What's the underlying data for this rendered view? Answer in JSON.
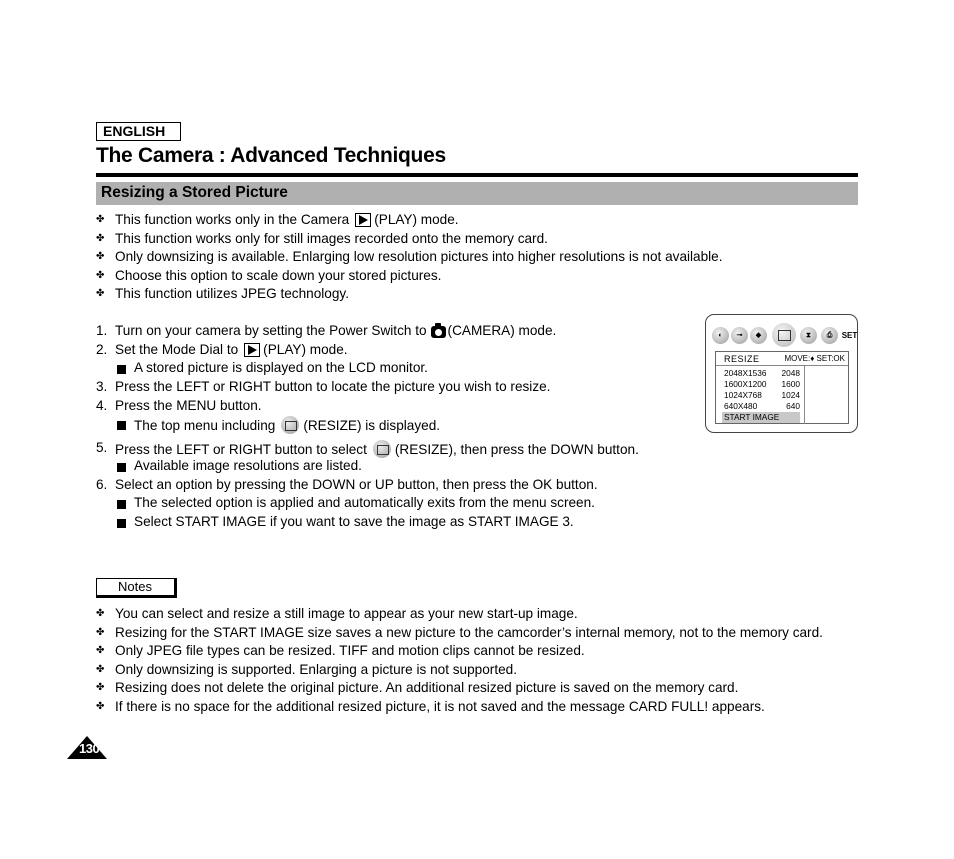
{
  "header": {
    "language": "ENGLISH",
    "title": "The Camera : Advanced Techniques",
    "section": "Resizing a Stored Picture"
  },
  "intro_bullets": [
    {
      "before": "This function works only in the Camera",
      "icon": "play-icon",
      "after": "(PLAY) mode."
    },
    {
      "text": "This function works only for still images recorded onto the memory card."
    },
    {
      "text": "Only downsizing is available. Enlarging low resolution pictures into higher resolutions is not available."
    },
    {
      "text": "Choose this option to scale down your stored pictures."
    },
    {
      "text": "This function utilizes JPEG technology."
    }
  ],
  "steps": [
    {
      "num": "1.",
      "before": "Turn on your camera by setting the Power Switch to",
      "icon": "camera-icon",
      "after": "(CAMERA) mode."
    },
    {
      "num": "2.",
      "before": "Set the Mode Dial to",
      "icon": "play-icon",
      "after": "(PLAY) mode."
    },
    {
      "sub": "A stored picture is displayed on the LCD monitor."
    },
    {
      "num": "3.",
      "text": "Press the LEFT or RIGHT button to locate the picture you wish to resize."
    },
    {
      "num": "4.",
      "text": "Press the MENU button."
    },
    {
      "sub_before": "The top menu including",
      "icon": "resize-icon",
      "sub_after": "(RESIZE) is displayed."
    },
    {
      "num": "5.",
      "before": "Press the LEFT or RIGHT button to select",
      "icon": "resize-icon",
      "after": "(RESIZE), then press the DOWN button."
    },
    {
      "sub": "Available image resolutions are listed."
    },
    {
      "num": "6.",
      "text": "Select an option by pressing the DOWN or UP button, then press the OK button."
    },
    {
      "sub": "The selected option is applied and automatically exits from the menu screen."
    },
    {
      "sub": "Select START IMAGE if you want to save the image as START IMAGE 3."
    }
  ],
  "lcd": {
    "top_icons": [
      "mode-icon",
      "key-icon",
      "dpad-icon",
      "resize-icon",
      "timer-icon",
      "print-icon",
      "set-icon"
    ],
    "set_label": "SET",
    "menu_title": "RESIZE",
    "hint": "MOVE:♦  SET:OK",
    "options": [
      {
        "res": "2048X1536",
        "value": "2048"
      },
      {
        "res": "1600X1200",
        "value": "1600"
      },
      {
        "res": "1024X768",
        "value": "1024"
      },
      {
        "res": "640X480",
        "value": "640"
      },
      {
        "res": "START IMAGE",
        "value": "",
        "selected": true
      }
    ]
  },
  "notes": {
    "label": "Notes",
    "items": [
      "You can select and resize a still image to appear as your new start-up image.",
      "Resizing for the START IMAGE size saves a new picture to the camcorder’s internal memory, not to the memory card.",
      "Only JPEG file types can be resized. TIFF and motion clips cannot be resized.",
      "Only downsizing is supported. Enlarging a picture is not supported.",
      "Resizing does not delete the original picture. An additional resized picture is saved on the memory card.",
      "If there is no space for the additional resized picture, it is not saved and the message  CARD FULL!  appears."
    ]
  },
  "footer": {
    "page_number": "130"
  }
}
